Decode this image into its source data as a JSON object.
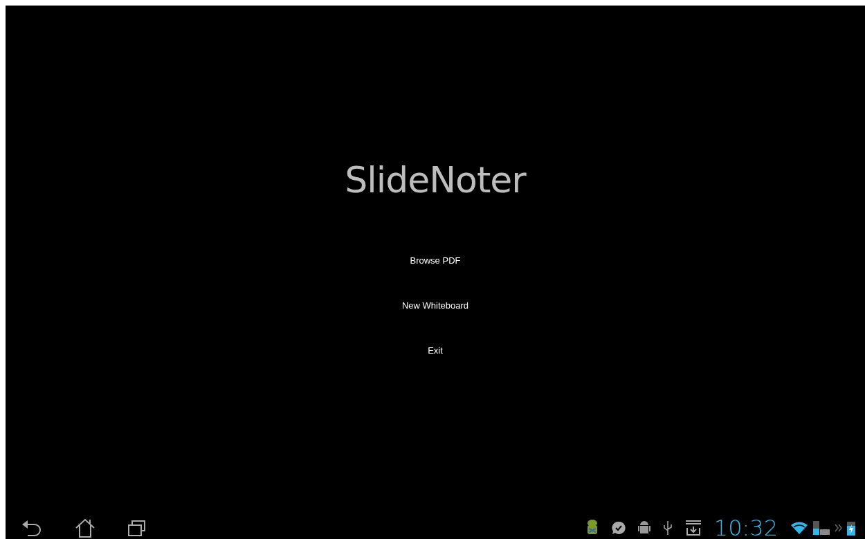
{
  "app": {
    "title": "SlideNoter",
    "menu": [
      "Browse PDF",
      "New Whiteboard",
      "Exit"
    ]
  },
  "status_bar": {
    "time": "10:32"
  }
}
